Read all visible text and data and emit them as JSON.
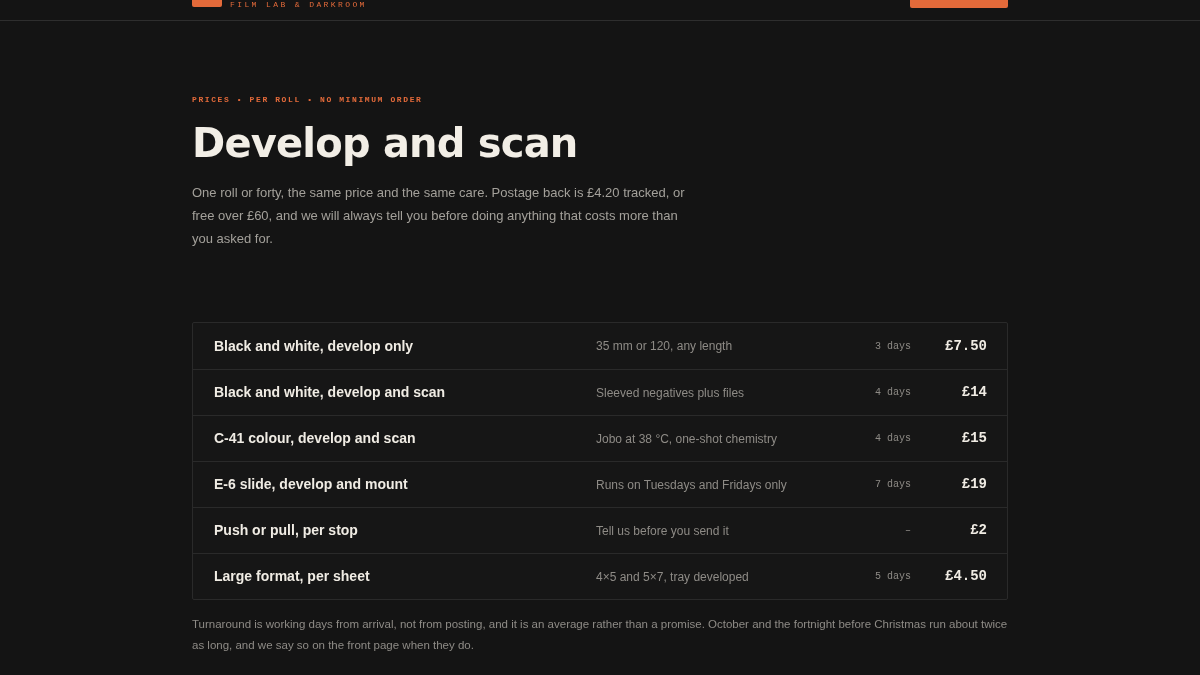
{
  "header": {
    "tagline": "FILM LAB & DARKROOM"
  },
  "eyebrow": "PRICES • PER ROLL • NO MINIMUM ORDER",
  "title": "Develop and scan",
  "intro": "One roll or forty, the same price and the same care. Postage back is £4.20 tracked, or free over £60, and we will always tell you before doing anything that costs more than you asked for.",
  "prices": [
    {
      "service": "Black and white, develop only",
      "detail": "35 mm or 120, any length",
      "turnaround": "3 days",
      "price": "£7.50"
    },
    {
      "service": "Black and white, develop and scan",
      "detail": "Sleeved negatives plus files",
      "turnaround": "4 days",
      "price": "£14"
    },
    {
      "service": "C-41 colour, develop and scan",
      "detail": "Jobo at 38 °C, one-shot chemistry",
      "turnaround": "4 days",
      "price": "£15"
    },
    {
      "service": "E-6 slide, develop and mount",
      "detail": "Runs on Tuesdays and Fridays only",
      "turnaround": "7 days",
      "price": "£19"
    },
    {
      "service": "Push or pull, per stop",
      "detail": "Tell us before you send it",
      "turnaround": "–",
      "price": "£2"
    },
    {
      "service": "Large format, per sheet",
      "detail": "4×5 and 5×7, tray developed",
      "turnaround": "5 days",
      "price": "£4.50"
    }
  ],
  "footnote": "Turnaround is working days from arrival, not from posting, and it is an average rather than a promise. October and the fortnight before Christmas run about twice as long, and we say so on the front page when they do."
}
